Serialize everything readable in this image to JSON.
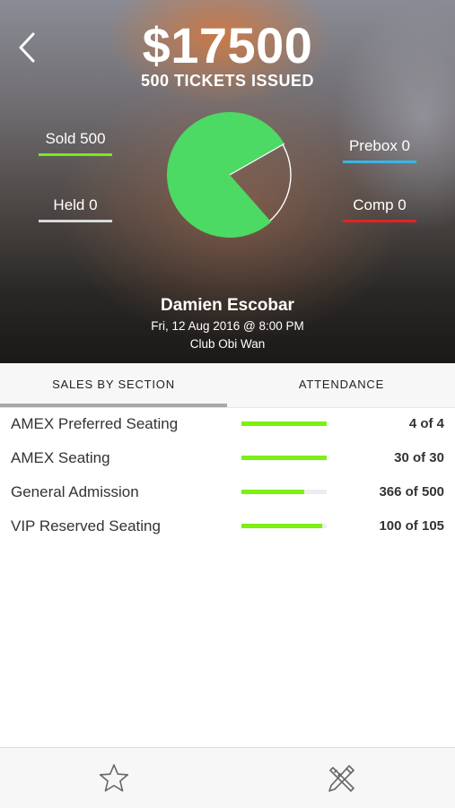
{
  "header": {
    "amount": "$17500",
    "tickets_issued": "500 TICKETS ISSUED"
  },
  "stats": {
    "sold": {
      "label": "Sold 500",
      "value": 500,
      "color": "#7be81c"
    },
    "held": {
      "label": "Held 0",
      "value": 0,
      "color": "#d8d8d8"
    },
    "prebox": {
      "label": "Prebox 0",
      "value": 0,
      "color": "#38b6e6"
    },
    "comp": {
      "label": "Comp 0",
      "value": 0,
      "color": "#e02424"
    }
  },
  "chart_data": {
    "type": "pie",
    "slices": [
      {
        "label": "Sold",
        "value": 500,
        "color": "#4cd964"
      },
      {
        "label": "Unsold",
        "value": 139,
        "color": "transparent"
      }
    ],
    "title": ""
  },
  "event": {
    "name": "Damien Escobar",
    "date": "Fri, 12 Aug 2016 @ 8:00 PM",
    "venue": "Club Obi Wan"
  },
  "tabs": [
    {
      "label": "SALES BY SECTION",
      "active": true
    },
    {
      "label": "ATTENDANCE",
      "active": false
    }
  ],
  "sections": [
    {
      "name": "AMEX Preferred Seating",
      "count": "4 of 4",
      "progress": 1.0
    },
    {
      "name": "AMEX Seating",
      "count": "30 of 30",
      "progress": 1.0
    },
    {
      "name": "General Admission",
      "count": "366 of 500",
      "progress": 0.732
    },
    {
      "name": "VIP Reserved Seating",
      "count": "100 of 105",
      "progress": 0.952
    }
  ],
  "colors": {
    "progress_fill": "#7cf012",
    "pie_fill": "#4cd964"
  },
  "icons": {
    "back": "chevron-left-icon",
    "favorite": "star-icon",
    "tools": "tools-icon"
  }
}
